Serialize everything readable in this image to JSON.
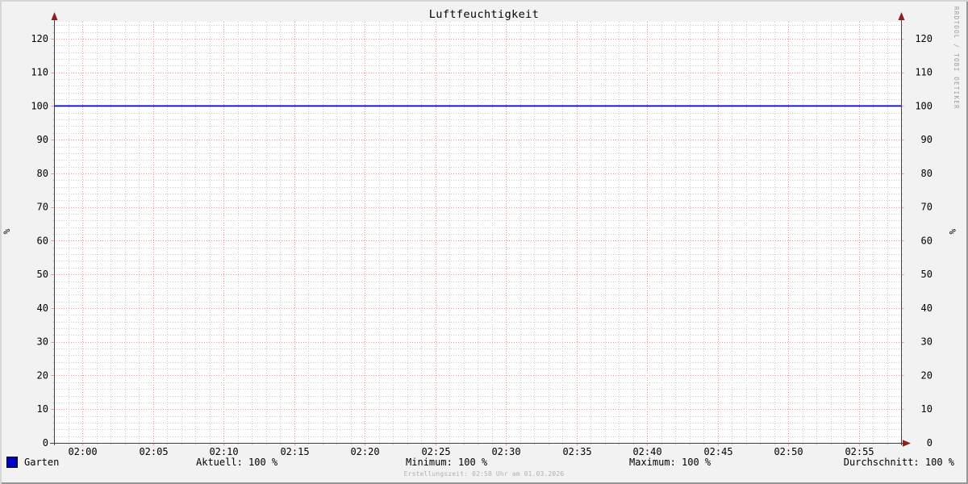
{
  "header": {
    "title": "Luftfeuchtigkeit"
  },
  "watermark": "RRDTOOL / TOBI OETIKER",
  "legend": {
    "series_label": "Garten",
    "aktuell": "Aktuell: 100 %",
    "minimum": "Minimum: 100 %",
    "maximum": "Maximum: 100 %",
    "durchschnitt": "Durchschnitt: 100 %"
  },
  "footer": {
    "creation": "Erstellungszeit: 02:58 Uhr am 01.03.2026"
  },
  "chart_data": {
    "type": "line",
    "title": "Luftfeuchtigkeit",
    "ylabel": "%",
    "ylabel_right": "%",
    "ylim": [
      0,
      125
    ],
    "y_major_step": 10,
    "y_minor_step": 2,
    "y_tick_labels": [
      "0",
      "10",
      "20",
      "30",
      "40",
      "50",
      "60",
      "70",
      "80",
      "90",
      "100",
      "110",
      "120"
    ],
    "x_tick_labels": [
      "02:00",
      "02:05",
      "02:10",
      "02:15",
      "02:20",
      "02:25",
      "02:30",
      "02:35",
      "02:40",
      "02:45",
      "02:50",
      "02:55"
    ],
    "x_window": {
      "start": "01:58",
      "end": "02:58",
      "minutes": 60,
      "label_start_offset_min": 2,
      "label_step_min": 5,
      "minor_step_min": 1
    },
    "grid": {
      "on": true,
      "canvas_color": "#ffffff",
      "minor_color": "#cbcbcb",
      "major_color": "#ff8f8f",
      "axis_color": "#404040",
      "arrow_color": "#8f1f1f"
    },
    "legend_position": "bottom",
    "series": [
      {
        "name": "Garten",
        "color": "#0000cc",
        "value": 100,
        "stats": {
          "aktuell": 100,
          "minimum": 100,
          "maximum": 100,
          "durchschnitt": 100
        }
      }
    ]
  }
}
